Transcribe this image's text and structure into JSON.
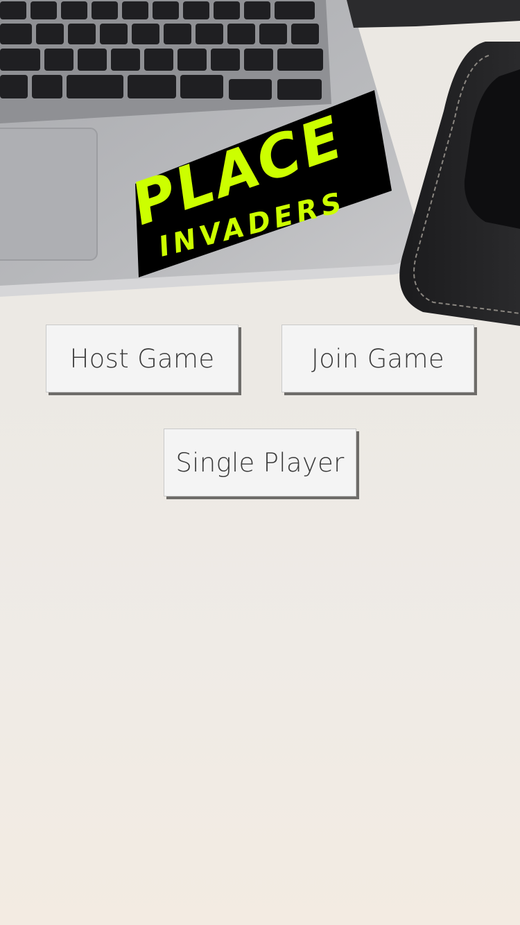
{
  "logo": {
    "line1": "PLACE",
    "line2": "INVADERS",
    "text_color": "#ccff00",
    "background_color": "#000000"
  },
  "menu": {
    "host_label": "Host Game",
    "join_label": "Join Game",
    "single_label": "Single Player"
  }
}
